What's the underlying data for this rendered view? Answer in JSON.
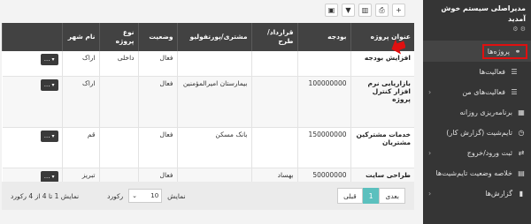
{
  "toolbar": [
    {
      "name": "add-icon",
      "glyph": "+"
    },
    {
      "name": "export-icon",
      "glyph": "⎙"
    },
    {
      "name": "columns-icon",
      "glyph": "▥"
    },
    {
      "name": "filter-icon",
      "glyph": "▼"
    },
    {
      "name": "save-icon",
      "glyph": "▣"
    }
  ],
  "table": {
    "headers": [
      "عنوان پروژه",
      "بودجه",
      "قرارداد/طرح",
      "مشتری/پورتفولیو",
      "وضعیت",
      "نوع پروژه",
      "نام شهر"
    ],
    "rows": [
      {
        "title": "افزایش بودجه",
        "budget": "",
        "contract": "",
        "customer": "",
        "status": "فعال",
        "type": "داخلی",
        "city": "اراک"
      },
      {
        "title": "بازاریابی نرم افزار کنترل پروژه",
        "budget": "100000000",
        "contract": "",
        "customer": "بیمارستان امیرالمؤمنین",
        "status": "فعال",
        "type": "",
        "city": "اراک"
      },
      {
        "title": "خدمات مشترکین مشتریان",
        "budget": "150000000",
        "contract": "",
        "customer": "بانک مسکن",
        "status": "فعال",
        "type": "",
        "city": "قم"
      },
      {
        "title": "طراحی سایت جدید",
        "budget": "50000000",
        "contract": "بهساد",
        "customer": "",
        "status": "فعال",
        "type": "",
        "city": "تبریز"
      }
    ],
    "action_label": "..."
  },
  "footer": {
    "prev": "قبلی",
    "page": "1",
    "next": "بعدی",
    "show_label": "نمایش",
    "page_size": "10",
    "records_label": "رکورد",
    "info": "نمایش 1 تا 4 از 4 رکورد"
  },
  "sidebar": {
    "user_name": "مدیراصلی سیستم خوش آمدید",
    "user_icons": "⚙ ⚙",
    "items": [
      {
        "label": "پروژه‌ها",
        "icon": "⚭",
        "name": "projects",
        "active": true,
        "chevron": false
      },
      {
        "label": "فعالیت‌ها",
        "icon": "☰",
        "name": "activities",
        "active": false,
        "chevron": false
      },
      {
        "label": "فعالیت‌های من",
        "icon": "☰",
        "name": "my-activities",
        "active": false,
        "chevron": true
      },
      {
        "label": "برنامه‌ریزی روزانه",
        "icon": "▦",
        "name": "daily-planning",
        "active": false,
        "chevron": false
      },
      {
        "label": "تایم‌شیت (گزارش کار)",
        "icon": "◷",
        "name": "timesheet",
        "active": false,
        "chevron": false
      },
      {
        "label": "ثبت ورود/خروج",
        "icon": "⇄",
        "name": "check-in-out",
        "active": false,
        "chevron": true
      },
      {
        "label": "خلاصه وضعیت تایم‌شیت‌ها",
        "icon": "▤",
        "name": "timesheet-summary",
        "active": false,
        "chevron": false
      },
      {
        "label": "گزارش‌ها",
        "icon": "▮",
        "name": "reports",
        "active": false,
        "chevron": true
      }
    ]
  }
}
